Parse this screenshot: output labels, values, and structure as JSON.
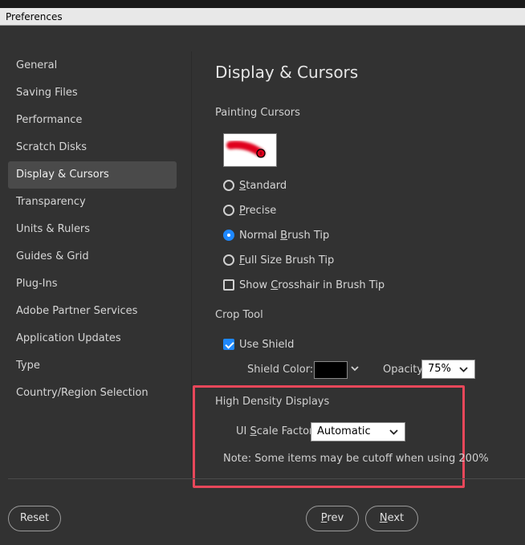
{
  "window": {
    "title": "Preferences"
  },
  "sidebar": {
    "items": [
      {
        "label": "General"
      },
      {
        "label": "Saving Files"
      },
      {
        "label": "Performance"
      },
      {
        "label": "Scratch Disks"
      },
      {
        "label": "Display & Cursors",
        "selected": true
      },
      {
        "label": "Transparency"
      },
      {
        "label": "Units & Rulers"
      },
      {
        "label": "Guides & Grid"
      },
      {
        "label": "Plug-Ins"
      },
      {
        "label": "Adobe Partner Services"
      },
      {
        "label": "Application Updates"
      },
      {
        "label": "Type"
      },
      {
        "label": "Country/Region Selection"
      }
    ]
  },
  "content": {
    "title": "Display & Cursors",
    "painting_cursors": {
      "label": "Painting Cursors",
      "options": [
        {
          "first": "S",
          "rest": "tandard",
          "checked": false
        },
        {
          "first": "P",
          "rest": "recise",
          "checked": false
        },
        {
          "prefix": "Normal ",
          "u": "B",
          "suffix": "rush Tip",
          "checked": true
        },
        {
          "first": "F",
          "rest": "ull Size Brush Tip",
          "checked": false
        }
      ],
      "crosshair": {
        "prefix": "Show ",
        "u": "C",
        "suffix": "rosshair in Brush Tip",
        "checked": false
      }
    },
    "crop_tool": {
      "label": "Crop Tool",
      "use_shield": {
        "label": "Use Shield",
        "checked": true
      },
      "shield_color_label": "Shield Color:",
      "shield_color": "#000000",
      "opacity_label": "Opacity:",
      "opacity_value": "75%"
    },
    "high_density": {
      "label": "High Density Displays",
      "ui_scale_label_prefix": "UI ",
      "ui_scale_label_u": "S",
      "ui_scale_label_suffix": "cale Factor:",
      "ui_scale_value": "Automatic",
      "note": "Note: Some items may be cutoff when using 200%"
    }
  },
  "buttons": {
    "reset": "Reset",
    "prev_u": "P",
    "prev_rest": "rev",
    "next_u": "N",
    "next_rest": "ext"
  },
  "colors": {
    "accent": "#1e88ff",
    "highlight": "#e8475a",
    "background": "#323232"
  }
}
